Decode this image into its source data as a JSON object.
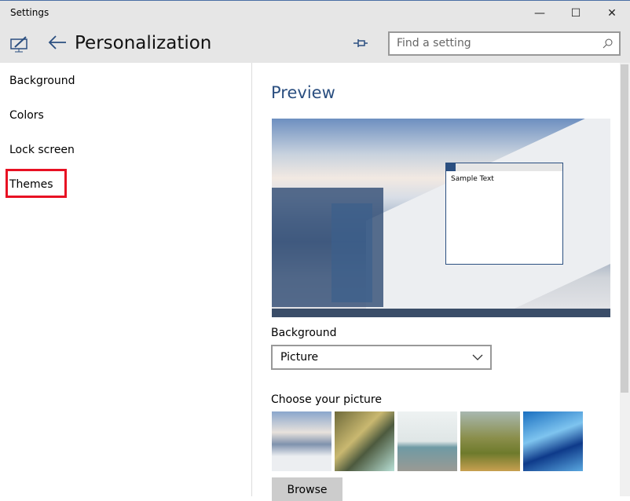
{
  "window": {
    "title": "Settings",
    "minimize": "—",
    "maximize": "☐",
    "close": "✕"
  },
  "header": {
    "title": "Personalization",
    "search_placeholder": "Find a setting"
  },
  "sidebar": {
    "items": [
      {
        "label": "Background"
      },
      {
        "label": "Colors"
      },
      {
        "label": "Lock screen"
      },
      {
        "label": "Themes"
      }
    ]
  },
  "main": {
    "heading": "Preview",
    "sample_text": "Sample Text",
    "background_label": "Background",
    "background_value": "Picture",
    "choose_label": "Choose your picture",
    "browse_label": "Browse"
  },
  "colors": {
    "accent": "#2b4f80",
    "highlight": "#e81123"
  }
}
